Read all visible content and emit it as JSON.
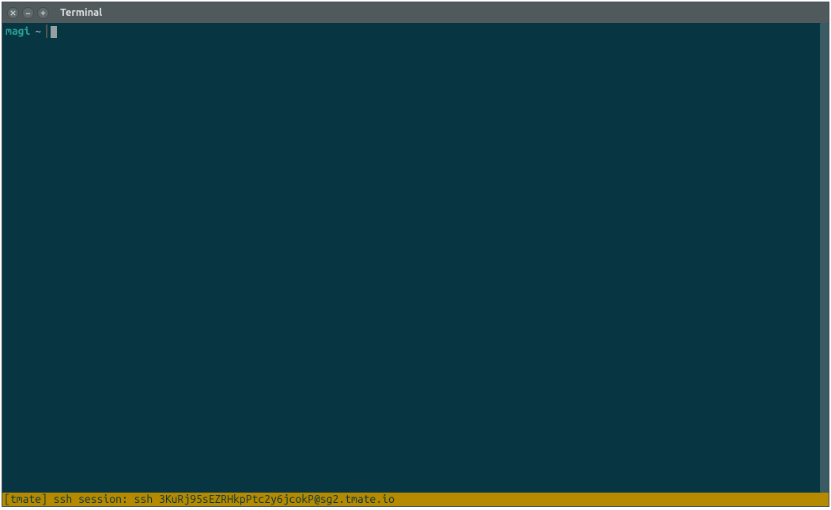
{
  "window": {
    "title": "Terminal"
  },
  "prompt": {
    "host": "magi",
    "path": "~"
  },
  "status": {
    "text": "[tmate] ssh session: ssh 3KuRj95sEZRHkpPtc2y6jcokP@sg2.tmate.io"
  }
}
